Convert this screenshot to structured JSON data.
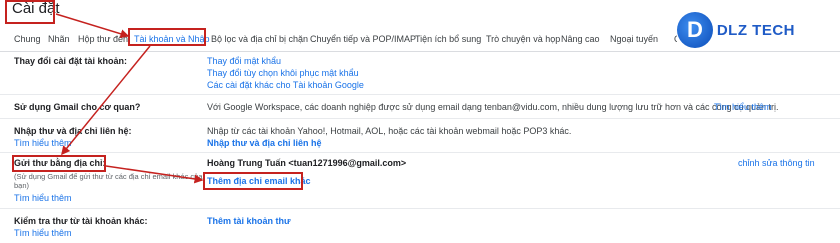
{
  "header": {
    "title": "Cài đặt"
  },
  "tabs": [
    {
      "label": "Chung"
    },
    {
      "label": "Nhãn"
    },
    {
      "label": "Hộp thư đến"
    },
    {
      "label": "Tài khoản và Nhập",
      "active": true
    },
    {
      "label": "Bộ lọc và địa chỉ bị chặn"
    },
    {
      "label": "Chuyển tiếp và POP/IMAP"
    },
    {
      "label": "Tiện ích bổ sung"
    },
    {
      "label": "Trò chuyện và họp"
    },
    {
      "label": "Nâng cao"
    },
    {
      "label": "Ngoại tuyến"
    },
    {
      "label": "Ch"
    }
  ],
  "logo": {
    "mark": "D",
    "text": "DLZ TECH"
  },
  "rows": {
    "change_settings": {
      "label": "Thay đổi cài đặt tài khoản:",
      "links": [
        "Thay đổi mật khẩu",
        "Thay đổi tùy chọn khôi phục mật khẩu",
        "Các cài đặt khác cho Tài khoản Google"
      ]
    },
    "workspace": {
      "label": "Sử dụng Gmail cho cơ quan?",
      "text": "Với Google Workspace, các doanh nghiệp được sử dụng email dạng tenban@vidu.com, nhiều dung lượng lưu trữ hơn và các công cụ quản trị.",
      "link": "Tìm hiểu thêm"
    },
    "import": {
      "label": "Nhập thư và địa chỉ liên hệ:",
      "help": "Tìm hiểu thêm",
      "text": "Nhập từ các tài khoản Yahoo!, Hotmail, AOL, hoặc các tài khoản webmail hoặc POP3 khác.",
      "link": "Nhập thư và địa chỉ liên hệ"
    },
    "send_as": {
      "label": "Gửi thư bằng địa chỉ:",
      "note": "(Sử dụng Gmail để gửi thư từ các địa chỉ email khác của bạn)",
      "help": "Tìm hiểu thêm",
      "account": "Hoàng Trung Tuấn <tuan1271996@gmail.com>",
      "edit": "chỉnh sửa thông tin",
      "add": "Thêm địa chỉ email khác"
    },
    "check_mail": {
      "label": "Kiểm tra thư từ tài khoản khác:",
      "help": "Tìm hiểu thêm",
      "link": "Thêm tài khoản thư"
    }
  },
  "colors": {
    "accent": "#1a73e8",
    "annotation": "#c5221f"
  }
}
